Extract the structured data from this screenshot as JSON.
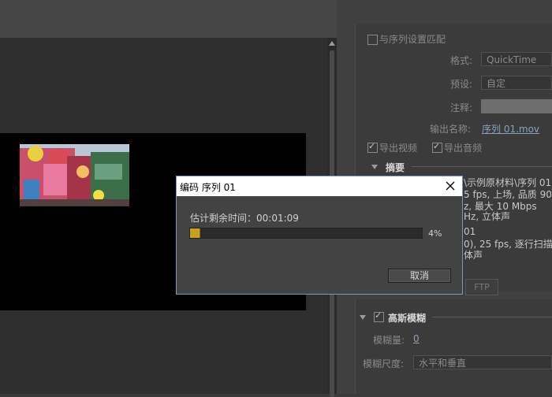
{
  "dialog": {
    "title": "编码 序列 01",
    "estimate_label": "估计剩余时间：00:01:09",
    "progress_fraction": 0.04,
    "progress_text": "4%",
    "cancel_label": "取消"
  },
  "export_settings": {
    "match_sequence_label": "与序列设置匹配",
    "format_label": "格式:",
    "format_value": "QuickTime",
    "preset_label": "预设:",
    "preset_value": "自定",
    "comment_label": "注释:",
    "output_name_label": "输出名称:",
    "output_name_value": "序列 01.mov",
    "export_video_label": "导出视频",
    "export_audio_label": "导出音频",
    "summary_heading": "摘要",
    "summary_lines": [
      "\\示例原材料\\序列 01",
      "5 fps, 上场, 品质 90,",
      "z, 最大 10 Mbps",
      "Hz, 立体声",
      "01",
      "0), 25 fps, 逐行扫描,",
      "体声"
    ],
    "ftp_label": "FTP"
  },
  "effects": {
    "gaussian_blur_label": "高斯模糊",
    "blurriness_label": "模糊量:",
    "blurriness_value": "0",
    "blur_dimensions_label": "模糊尺度:",
    "blur_dimensions_value": "水平和垂直"
  },
  "colors": {
    "progress_fill": "#c8a020",
    "dialog_border": "#7a9ab8"
  }
}
